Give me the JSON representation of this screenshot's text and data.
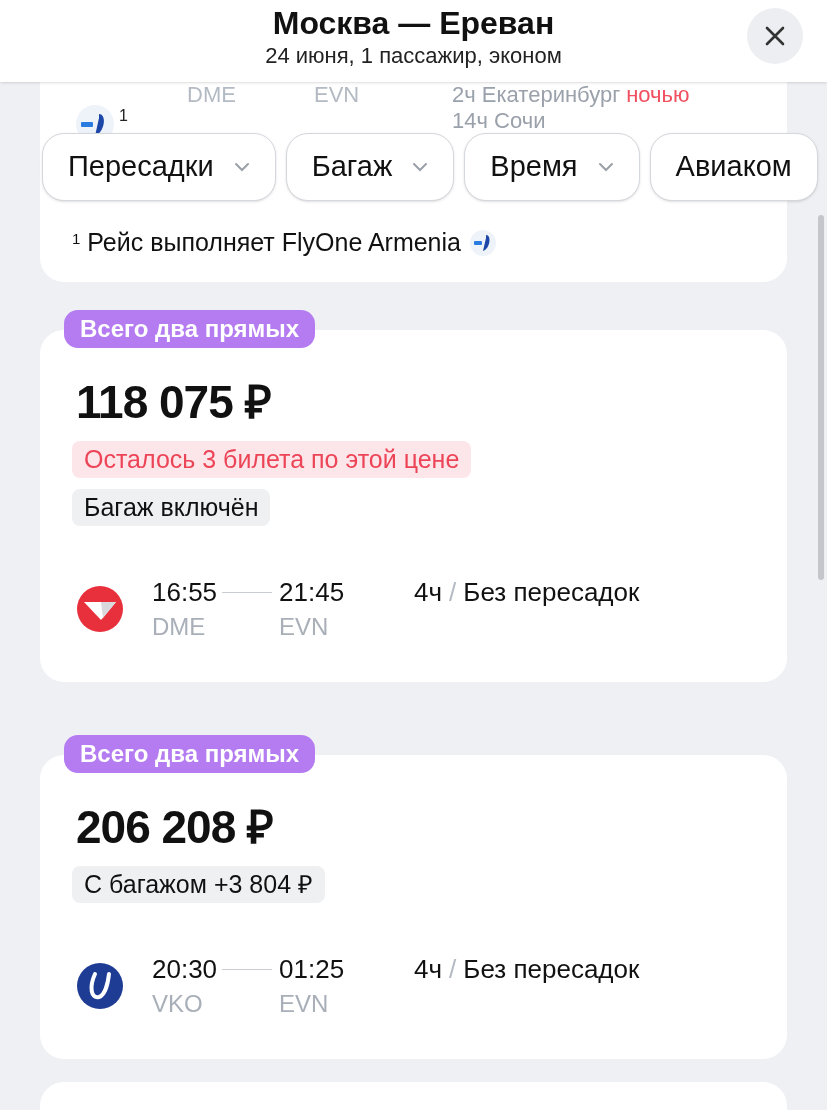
{
  "header": {
    "title": "Москва — Ереван",
    "subtitle": "24 июня, 1 пассажир, эконом"
  },
  "previous_offer": {
    "depart_code": "DME",
    "arrive_code": "EVN",
    "operator_mark": "1",
    "connections": [
      {
        "text": "2ч Екатеринбург",
        "note": "ночью"
      },
      {
        "text": "14ч Сочи"
      }
    ],
    "footnote": {
      "mark": "1",
      "text": "Рейс выполняет FlyOne Armenia"
    }
  },
  "filters": [
    {
      "label": "Пересадки"
    },
    {
      "label": "Багаж"
    },
    {
      "label": "Время"
    },
    {
      "label": "Авиаком"
    }
  ],
  "offers": [
    {
      "badge": "Всего два прямых",
      "price": "118 075 ₽",
      "tags": [
        {
          "kind": "warning",
          "text": "Осталось 3 билета по этой цене"
        },
        {
          "kind": "neutral",
          "text": "Багаж включён"
        }
      ],
      "logo": {
        "kind": "red"
      },
      "flight": {
        "depart_time": "16:55",
        "arrive_time": "21:45",
        "depart_code": "DME",
        "arrive_code": "EVN",
        "duration": "4ч",
        "separator": "/",
        "stops": "Без пересадок"
      }
    },
    {
      "badge": "Всего два прямых",
      "price": "206 208 ₽",
      "tags": [
        {
          "kind": "neutral",
          "text": "С багажом +3 804 ₽"
        }
      ],
      "logo": {
        "kind": "blue"
      },
      "flight": {
        "depart_time": "20:30",
        "arrive_time": "01:25",
        "depart_code": "VKO",
        "arrive_code": "EVN",
        "duration": "4ч",
        "separator": "/",
        "stops": "Без пересадок"
      }
    }
  ]
}
